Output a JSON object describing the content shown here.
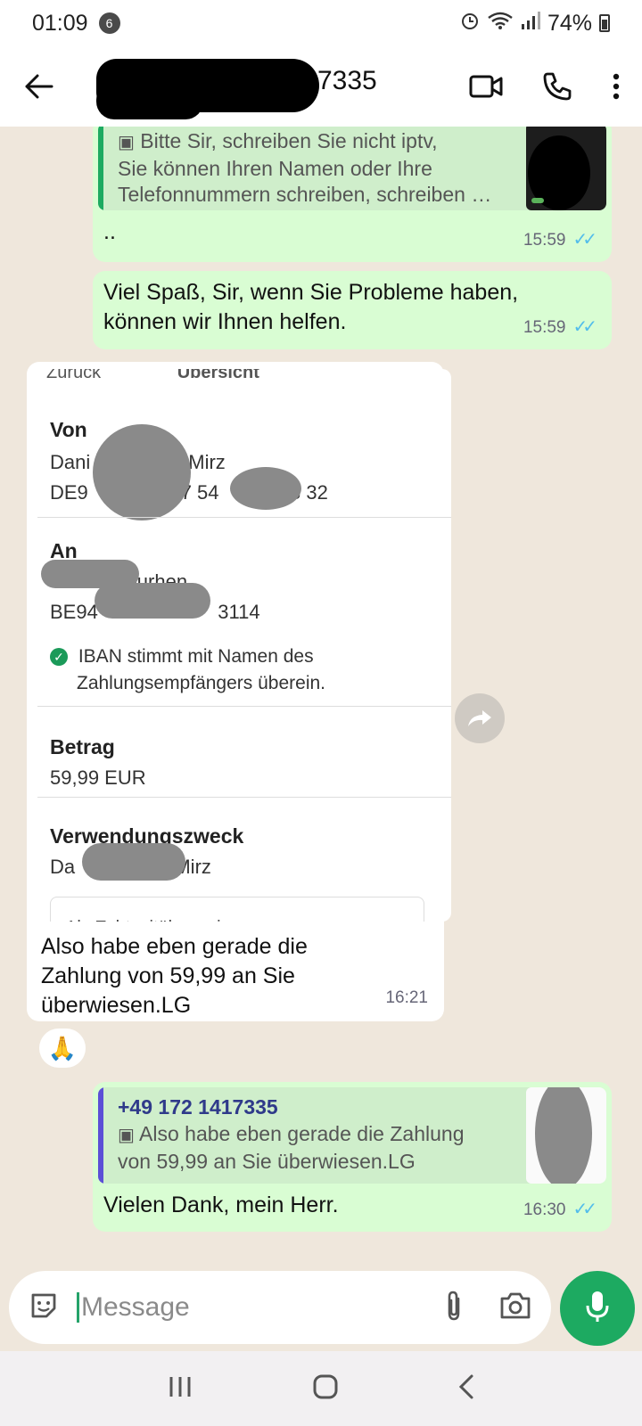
{
  "status_bar": {
    "time": "01:09",
    "notification_count": "6",
    "battery": "74%"
  },
  "header": {
    "contact_visible": "7335"
  },
  "messages": {
    "msg1": {
      "quote_text": "Bitte Sir, schreiben Sie nicht iptv, Sie können Ihren Namen oder Ihre Telefonnummern schreiben, schreiben …",
      "quote_line1": "Bitte Sir, schreiben Sie nicht iptv,",
      "quote_line2": "Sie können Ihren Namen oder Ihre",
      "quote_line3": "Telefonnummern schreiben, schreiben …",
      "text": "..",
      "time": "15:59"
    },
    "msg2": {
      "line1": "Viel Spaß, Sir, wenn Sie Probleme haben,",
      "line2": "können wir Ihnen helfen.",
      "time": "15:59"
    },
    "msg3": {
      "bank": {
        "top_left": "Zurück",
        "top_center": "Übersicht",
        "von_label": "Von",
        "von_name": "Dani                  Mirz",
        "von_iban": "DE9                 7 54             3 32",
        "an_label": "An",
        "an_name": "              ourhen",
        "an_iban": "BE94                      3114",
        "iban_check": "IBAN stimmt mit Namen des",
        "iban_check2": "Zahlungsempfängers überein.",
        "betrag_label": "Betrag",
        "betrag_value": "59,99 EUR",
        "zweck_label": "Verwendungszweck",
        "zweck_value": "Da                 -Mirz",
        "echtzeit": "Als Echtzeitüberweisung"
      },
      "line1": "Also habe eben gerade die",
      "line2": "Zahlung von 59,99 an Sie",
      "line3": "überwiesen.LG",
      "time": "16:21",
      "reaction": "🙏"
    },
    "msg4": {
      "quote_author": "+49 172 1417335",
      "quote_line1": "Also habe eben gerade die Zahlung",
      "quote_line2": "von 59,99 an Sie überwiesen.LG",
      "text": "Vielen Dank, mein Herr.",
      "time": "16:30"
    }
  },
  "input": {
    "placeholder": "Message"
  },
  "colors": {
    "outgoing_bubble": "#d9fdd3",
    "incoming_bubble": "#ffffff",
    "read_ticks": "#53bdeb",
    "mic_button": "#1daa61",
    "quote_bar_msg1": "#1daa61",
    "quote_bar_msg4": "#5b4fd6"
  }
}
